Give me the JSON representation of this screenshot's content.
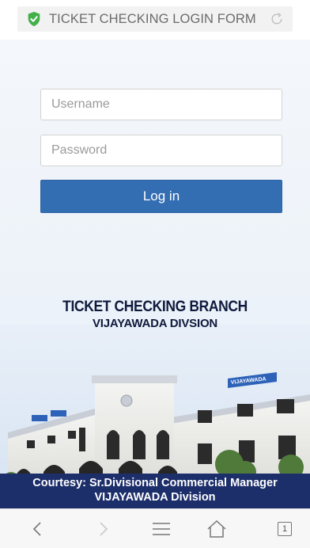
{
  "browser": {
    "page_title": "TICKET CHECKING LOGIN FORM",
    "security_icon": "shield-check-icon",
    "reload_icon": "reload-icon",
    "accent_color": "#4caf50"
  },
  "form": {
    "username_placeholder": "Username",
    "password_placeholder": "Password",
    "login_label": "Log in",
    "button_color": "#336eb3"
  },
  "banner": {
    "title": "TICKET CHECKING BRANCH",
    "subtitle": "VIJAYAWADA DIVSION",
    "building_sign": "VIJAYAWADA",
    "courtesy_line1": "Courtesy: Sr.Divisional Commercial Manager",
    "courtesy_line2": "VIJAYAWADA Division"
  },
  "navbar": {
    "tab_count": "1",
    "icons": [
      "back-icon",
      "forward-icon",
      "menu-icon",
      "home-icon",
      "tabs-icon"
    ]
  }
}
